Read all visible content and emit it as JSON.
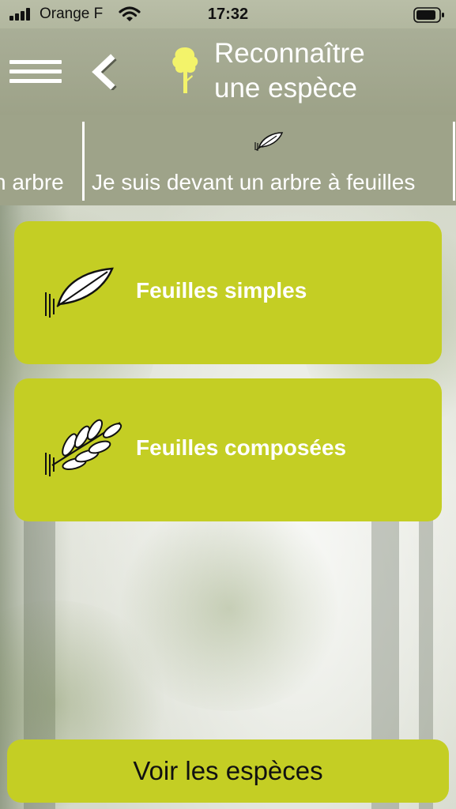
{
  "status_bar": {
    "carrier": "Orange F",
    "time": "17:32",
    "signal_bars": 4
  },
  "header": {
    "title": "Reconnaître\nune espèce",
    "icons": [
      "menu-icon",
      "back-chevron-icon",
      "tree-icon"
    ],
    "tree_icon_color": "#f3f36a"
  },
  "breadcrumb": {
    "previous": "n arbre",
    "current": "Je suis devant un arbre à feuilles",
    "current_icon": "leaf-icon"
  },
  "options": [
    {
      "label": "Feuilles simples",
      "icon": "simple-leaf-icon"
    },
    {
      "label": "Feuilles composées",
      "icon": "compound-leaf-icon"
    }
  ],
  "footer": {
    "button_label": "Voir les espèces"
  },
  "colors": {
    "accent": "#c4ce24",
    "header": "#a4a98f",
    "text_on_accent": "#ffffff"
  }
}
